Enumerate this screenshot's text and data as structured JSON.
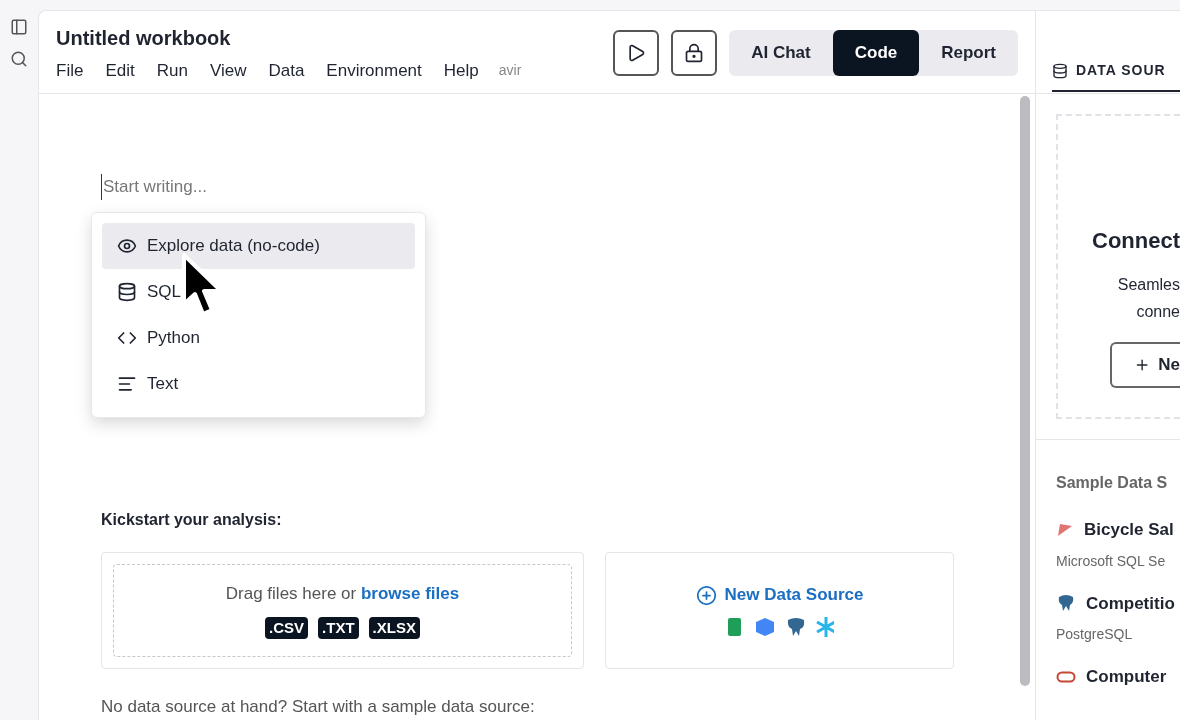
{
  "workbook": {
    "title": "Untitled workbook",
    "menu": [
      "File",
      "Edit",
      "Run",
      "View",
      "Data",
      "Environment",
      "Help"
    ],
    "user": "avir"
  },
  "toolbar": {
    "modes": [
      {
        "label": "AI Chat",
        "selected": false
      },
      {
        "label": "Code",
        "selected": true
      },
      {
        "label": "Report",
        "selected": false
      }
    ]
  },
  "editor": {
    "placeholder": "Start writing...",
    "insert_menu": [
      {
        "kind": "eye",
        "label": "Explore data (no-code)",
        "selected": true
      },
      {
        "kind": "database",
        "label": "SQL",
        "selected": false
      },
      {
        "kind": "code",
        "label": "Python",
        "selected": false
      },
      {
        "kind": "text",
        "label": "Text",
        "selected": false
      }
    ]
  },
  "kickstart": {
    "heading": "Kickstart your analysis:",
    "drop_text": "Drag files here or",
    "browse_link": "browse files",
    "file_types": [
      ".CSV",
      ".TXT",
      ".XLSX"
    ],
    "new_source": "New Data Source",
    "sample_hint": "No data source at hand? Start with a sample data source:"
  },
  "data_sources": {
    "tab": "DATA SOUR",
    "connect_title": "Connect",
    "connect_text": [
      "Seamles",
      "conne"
    ],
    "connect_button": "Ne",
    "sample_heading": "Sample Data S",
    "samples": [
      {
        "kind": "mssql",
        "name": "Bicycle Sal",
        "engine": "Microsoft SQL Se"
      },
      {
        "kind": "postgres",
        "name": "Competitio",
        "engine": "PostgreSQL"
      },
      {
        "kind": "oracle",
        "name": "Computer"
      }
    ]
  }
}
